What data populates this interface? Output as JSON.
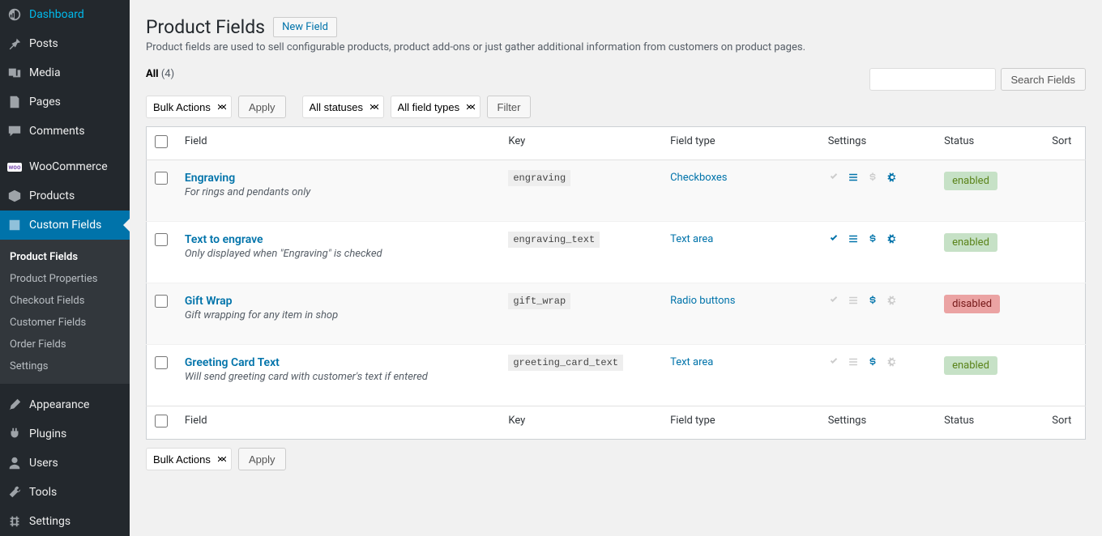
{
  "sidebar": {
    "items": [
      {
        "label": "Dashboard",
        "icon": "dashboard"
      },
      {
        "label": "Posts",
        "icon": "pin"
      },
      {
        "label": "Media",
        "icon": "media"
      },
      {
        "label": "Pages",
        "icon": "pages"
      },
      {
        "label": "Comments",
        "icon": "comments"
      },
      {
        "label": "WooCommerce",
        "icon": "woo"
      },
      {
        "label": "Products",
        "icon": "products"
      },
      {
        "label": "Custom Fields",
        "icon": "customfields",
        "current": true
      },
      {
        "label": "Appearance",
        "icon": "appearance"
      },
      {
        "label": "Plugins",
        "icon": "plugins"
      },
      {
        "label": "Users",
        "icon": "users"
      },
      {
        "label": "Tools",
        "icon": "tools"
      },
      {
        "label": "Settings",
        "icon": "settings"
      }
    ],
    "submenu": [
      {
        "label": "Product Fields",
        "active": true
      },
      {
        "label": "Product Properties"
      },
      {
        "label": "Checkout Fields"
      },
      {
        "label": "Customer Fields"
      },
      {
        "label": "Order Fields"
      },
      {
        "label": "Settings"
      }
    ]
  },
  "header": {
    "title": "Product Fields",
    "new_button": "New Field",
    "description": "Product fields are used to sell configurable products, product add-ons or just gather additional information from customers on product pages."
  },
  "filters": {
    "all_label": "All",
    "count": "(4)",
    "bulk_label": "Bulk Actions",
    "apply_label": "Apply",
    "statuses_label": "All statuses",
    "types_label": "All field types",
    "filter_label": "Filter",
    "search_button": "Search Fields"
  },
  "table": {
    "columns": {
      "field": "Field",
      "key": "Key",
      "type": "Field type",
      "settings": "Settings",
      "status": "Status",
      "sort": "Sort"
    },
    "status_labels": {
      "enabled": "enabled",
      "disabled": "disabled"
    },
    "rows": [
      {
        "title": "Engraving",
        "desc": "For rings and pendants only",
        "key": "engraving",
        "type": "Checkboxes",
        "settings": {
          "check": false,
          "list": true,
          "dollar": false,
          "gears": true
        },
        "status": "enabled"
      },
      {
        "title": "Text to engrave",
        "desc": "Only displayed when \"Engraving\" is checked",
        "key": "engraving_text",
        "type": "Text area",
        "settings": {
          "check": true,
          "list": true,
          "dollar": true,
          "gears": true
        },
        "status": "enabled"
      },
      {
        "title": "Gift Wrap",
        "desc": "Gift wrapping for any item in shop",
        "key": "gift_wrap",
        "type": "Radio buttons",
        "settings": {
          "check": false,
          "list": false,
          "dollar": true,
          "gears": false
        },
        "status": "disabled"
      },
      {
        "title": "Greeting Card Text",
        "desc": "Will send greeting card with customer's text if entered",
        "key": "greeting_card_text",
        "type": "Text area",
        "settings": {
          "check": false,
          "list": false,
          "dollar": true,
          "gears": false
        },
        "status": "enabled"
      }
    ]
  }
}
